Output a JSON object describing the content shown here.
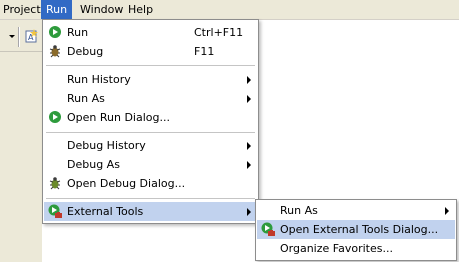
{
  "menubar": {
    "items": [
      {
        "label": "Project"
      },
      {
        "label": "Run"
      },
      {
        "label": "Window"
      },
      {
        "label": "Help"
      }
    ]
  },
  "run_menu": {
    "items": [
      {
        "label": "Run",
        "shortcut": "Ctrl+F11",
        "icon": "run-icon"
      },
      {
        "label": "Debug",
        "shortcut": "F11",
        "icon": "debug-icon"
      },
      {
        "label": "Run History",
        "submenu": true
      },
      {
        "label": "Run As",
        "submenu": true
      },
      {
        "label": "Open Run Dialog...",
        "icon": "run-dialog-icon"
      },
      {
        "label": "Debug History",
        "submenu": true
      },
      {
        "label": "Debug As",
        "submenu": true
      },
      {
        "label": "Open Debug Dialog...",
        "icon": "debug-dialog-icon"
      },
      {
        "label": "External Tools",
        "submenu": true,
        "icon": "external-tools-icon"
      }
    ]
  },
  "external_tools_menu": {
    "items": [
      {
        "label": "Run As",
        "submenu": true
      },
      {
        "label": "Open External Tools Dialog...",
        "icon": "external-tools-icon"
      },
      {
        "label": "Organize Favorites..."
      }
    ]
  },
  "colors": {
    "menubar_bg": "#ece9d8",
    "active_menu": "#316ac5",
    "highlight": "#c1d2ee",
    "menu_border": "#8d8d8d"
  }
}
